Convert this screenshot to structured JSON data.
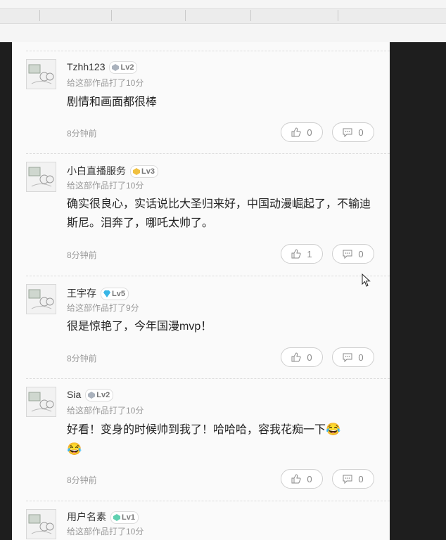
{
  "comments": [
    {
      "username": "Tzhh123",
      "level": "Lv2",
      "level_color": "#aab2bd",
      "rating": "给这部作品打了10分",
      "text": "剧情和画面都很棒",
      "time": "8分钟前",
      "likes": "0",
      "replies": "0"
    },
    {
      "username": "小白直播服务",
      "level": "Lv3",
      "level_color": "#f0c040",
      "rating": "给这部作品打了10分",
      "text": "确实很良心，实话说比大圣归来好，中国动漫崛起了，不输迪斯尼。泪奔了，哪吒太帅了。",
      "time": "8分钟前",
      "likes": "1",
      "replies": "0"
    },
    {
      "username": "王宇存",
      "level": "Lv5",
      "level_color": "#38b6e6",
      "rating": "给这部作品打了9分",
      "text": "很是惊艳了，今年国漫mvp！",
      "time": "8分钟前",
      "likes": "0",
      "replies": "0"
    },
    {
      "username": "Sia",
      "level": "Lv2",
      "level_color": "#aab2bd",
      "rating": "给这部作品打了10分",
      "text": "好看！变身的时候帅到我了！哈哈哈，容我花痴一下",
      "text_emoji": "😂",
      "text_emoji2": "😂",
      "time": "8分钟前",
      "likes": "0",
      "replies": "0"
    },
    {
      "username": "用户名素",
      "level": "Lv1",
      "level_color": "#5fd0b0",
      "rating": "给这部作品打了10分"
    }
  ]
}
